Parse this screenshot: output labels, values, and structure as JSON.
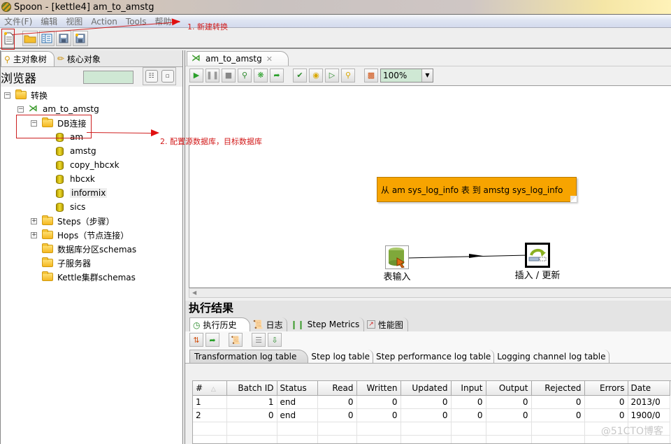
{
  "window": {
    "title": "Spoon - [kettle4] am_to_amstg"
  },
  "menu": [
    "文件(F)",
    "编辑",
    "视图",
    "Action",
    "Tools",
    "帮助"
  ],
  "toolbar": {
    "buttons": [
      "new-file-icon",
      "open-folder-icon",
      "explore-icon",
      "save-icon",
      "save-as-icon"
    ]
  },
  "annotations": {
    "step1": "1. 新建转换",
    "step2": "2. 配置源数据库，目标数据库"
  },
  "left_panel": {
    "tabs": [
      {
        "label": "主对象树",
        "active": true
      },
      {
        "label": "核心对象",
        "active": false
      }
    ],
    "browser_title": "浏览器",
    "filter_value": "",
    "tree": {
      "root": "转换",
      "transformation": "am_to_amstg",
      "db_folder": "DB连接",
      "connections": [
        "am",
        "amstg",
        "copy_hbcxk",
        "hbcxk",
        "informix",
        "sics"
      ],
      "highlighted_connection": "informix",
      "other_nodes": [
        {
          "label": "Steps（步骤）",
          "expandable": true
        },
        {
          "label": "Hops（节点连接）",
          "expandable": true
        },
        {
          "label": "数据库分区schemas",
          "expandable": false
        },
        {
          "label": "子服务器",
          "expandable": false
        },
        {
          "label": "Kettle集群schemas",
          "expandable": false
        }
      ]
    }
  },
  "editor": {
    "tab_label": "am_to_amstg",
    "zoom_value": "100%",
    "note_text": "从 am sys_log_info 表 到 amstg sys_log_info",
    "steps": [
      {
        "label": "表输入",
        "type": "table-input"
      },
      {
        "label": "插入 / 更新",
        "type": "insert-update",
        "selected": true
      }
    ]
  },
  "results": {
    "title": "执行结果",
    "tabs": [
      {
        "label": "执行历史",
        "active": true
      },
      {
        "label": "日志",
        "active": false
      },
      {
        "label": "Step Metrics",
        "active": false
      },
      {
        "label": "性能图",
        "active": false
      }
    ],
    "log_tabs": [
      {
        "label": "Transformation log table",
        "active": true
      },
      {
        "label": "Step log table",
        "active": false
      },
      {
        "label": "Step performance log table",
        "active": false
      },
      {
        "label": "Logging channel log table",
        "active": false
      }
    ],
    "table": {
      "columns": [
        "#",
        "Batch ID",
        "Status",
        "Read",
        "Written",
        "Updated",
        "Input",
        "Output",
        "Rejected",
        "Errors",
        "Date"
      ],
      "rows": [
        [
          "1",
          "1",
          "end",
          "0",
          "0",
          "0",
          "0",
          "0",
          "0",
          "0",
          "2013/0"
        ],
        [
          "2",
          "0",
          "end",
          "0",
          "0",
          "0",
          "0",
          "0",
          "0",
          "0",
          "1900/0"
        ]
      ]
    }
  },
  "watermark": "@51CTO博客"
}
